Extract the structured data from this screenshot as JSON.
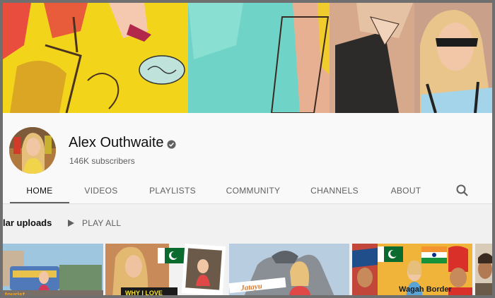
{
  "channel": {
    "name": "Alex Outhwaite",
    "subscribers": "146K subscribers"
  },
  "tabs": [
    {
      "label": "HOME",
      "active": true
    },
    {
      "label": "VIDEOS"
    },
    {
      "label": "PLAYLISTS"
    },
    {
      "label": "COMMUNITY"
    },
    {
      "label": "CHANNELS"
    },
    {
      "label": "ABOUT"
    }
  ],
  "section": {
    "title": "lar uploads",
    "play_all": "PLAY ALL"
  },
  "thumbnails": [
    {
      "caption": "tourist"
    },
    {
      "caption": "WHY I LOVE"
    },
    {
      "caption": "Jatayu"
    },
    {
      "caption": "Wagah Border"
    },
    {
      "caption": ""
    }
  ],
  "icons": {
    "verified": "verified-check-icon",
    "search": "search-icon",
    "play": "play-icon"
  },
  "colors": {
    "text_primary": "#0f0f0f",
    "text_secondary": "#606060",
    "background": "#f9f9f9"
  }
}
